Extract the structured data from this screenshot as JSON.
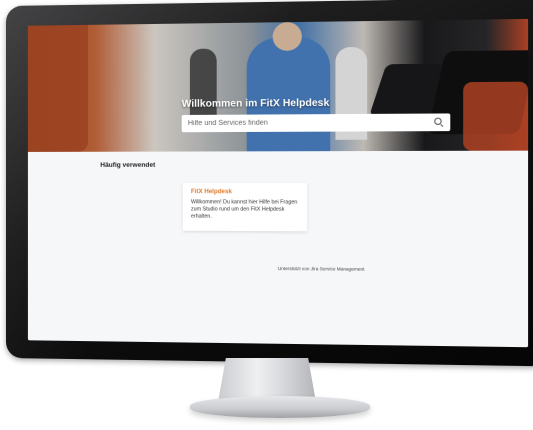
{
  "hero": {
    "title": "Willkommen im FitX Helpdesk",
    "search_placeholder": "Hilfe und Services finden"
  },
  "main": {
    "section_title": "Häufig verwendet",
    "cards": [
      {
        "title": "FitX Helpdesk",
        "text": "Willkommen! Du kannst hier Hilfe bei Fragen zum Studio rund um den FitX Helpdesk erhalten."
      }
    ],
    "footer": "Unterstützt von Jira Service Management"
  },
  "colors": {
    "accent": "#e07a2a",
    "page_bg": "#f6f7f9",
    "bezel": "#111111"
  },
  "icons": {
    "search": "search-icon"
  }
}
